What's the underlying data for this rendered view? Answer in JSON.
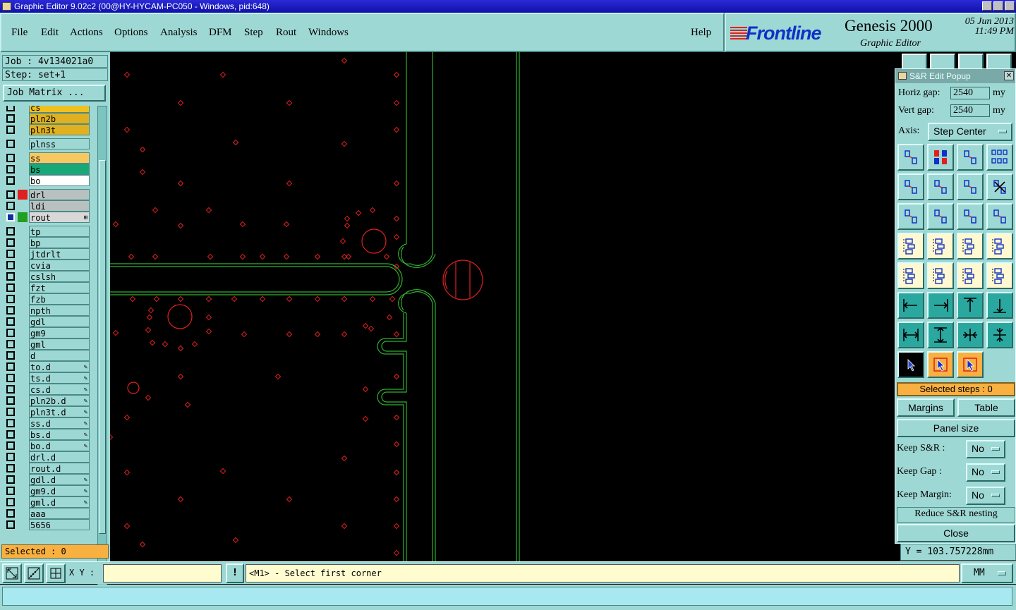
{
  "window": {
    "title": "Graphic Editor 9.02c2 (00@HY-HYCAM-PC050 - Windows, pid:648)"
  },
  "menu": {
    "items": [
      "File",
      "Edit",
      "Actions",
      "Options",
      "Analysis",
      "DFM",
      "Step",
      "Rout",
      "Windows"
    ],
    "help": "Help"
  },
  "brand": {
    "logo": "Frontline",
    "product": "Genesis 2000",
    "date": "05 Jun 2013",
    "time": "11:49 PM",
    "subtitle": "Graphic Editor"
  },
  "job": {
    "job_label": "Job  : 4v134021a0",
    "step_label": "Step: set+1",
    "matrix_button": "Job Matrix ...",
    "selected": "Selected : 0"
  },
  "layers": [
    {
      "name": "cs",
      "bg": "#f0c020",
      "swatch": ""
    },
    {
      "name": "pln2b",
      "bg": "#e0b020",
      "swatch": ""
    },
    {
      "name": "pln3t",
      "bg": "#e0b020",
      "swatch": ""
    },
    {
      "name": "plnss",
      "bg": "#9ed8d4",
      "swatch": ""
    },
    {
      "name": "ss",
      "bg": "#f8c860",
      "swatch": ""
    },
    {
      "name": "bs",
      "bg": "#18a878",
      "swatch": ""
    },
    {
      "name": "bo",
      "bg": "#ffffff",
      "swatch": ""
    },
    {
      "name": "drl",
      "bg": "#b8c0c0",
      "swatch": "#e02020"
    },
    {
      "name": "ldi",
      "bg": "#b8c0c0",
      "swatch": ""
    },
    {
      "name": "rout",
      "bg": "#d8d8d8",
      "swatch": "#20a020",
      "mark": "⊞",
      "active": true
    },
    {
      "name": "tp",
      "bg": "#9ed8d4",
      "swatch": ""
    },
    {
      "name": "bp",
      "bg": "#9ed8d4",
      "swatch": ""
    },
    {
      "name": "jtdrlt",
      "bg": "#9ed8d4",
      "swatch": ""
    },
    {
      "name": "cvia",
      "bg": "#9ed8d4",
      "swatch": ""
    },
    {
      "name": "cslsh",
      "bg": "#9ed8d4",
      "swatch": ""
    },
    {
      "name": "fzt",
      "bg": "#9ed8d4",
      "swatch": ""
    },
    {
      "name": "fzb",
      "bg": "#9ed8d4",
      "swatch": ""
    },
    {
      "name": "npth",
      "bg": "#9ed8d4",
      "swatch": ""
    },
    {
      "name": "gdl",
      "bg": "#9ed8d4",
      "swatch": ""
    },
    {
      "name": "gm9",
      "bg": "#9ed8d4",
      "swatch": ""
    },
    {
      "name": "gml",
      "bg": "#9ed8d4",
      "swatch": ""
    },
    {
      "name": "d",
      "bg": "#9ed8d4",
      "swatch": ""
    },
    {
      "name": "to.d",
      "bg": "#9ed8d4",
      "swatch": "",
      "mark": "✎"
    },
    {
      "name": "ts.d",
      "bg": "#9ed8d4",
      "swatch": "",
      "mark": "✎"
    },
    {
      "name": "cs.d",
      "bg": "#9ed8d4",
      "swatch": "",
      "mark": "✎"
    },
    {
      "name": "pln2b.d",
      "bg": "#9ed8d4",
      "swatch": "",
      "mark": "✎"
    },
    {
      "name": "pln3t.d",
      "bg": "#9ed8d4",
      "swatch": "",
      "mark": "✎"
    },
    {
      "name": "ss.d",
      "bg": "#9ed8d4",
      "swatch": "",
      "mark": "✎"
    },
    {
      "name": "bs.d",
      "bg": "#9ed8d4",
      "swatch": "",
      "mark": "✎"
    },
    {
      "name": "bo.d",
      "bg": "#9ed8d4",
      "swatch": "",
      "mark": "✎"
    },
    {
      "name": "drl.d",
      "bg": "#9ed8d4",
      "swatch": ""
    },
    {
      "name": "rout.d",
      "bg": "#9ed8d4",
      "swatch": ""
    },
    {
      "name": "gdl.d",
      "bg": "#9ed8d4",
      "swatch": "",
      "mark": "✎"
    },
    {
      "name": "gm9.d",
      "bg": "#9ed8d4",
      "swatch": "",
      "mark": "✎"
    },
    {
      "name": "gml.d",
      "bg": "#9ed8d4",
      "swatch": "",
      "mark": "✎"
    },
    {
      "name": "aaa",
      "bg": "#9ed8d4",
      "swatch": ""
    },
    {
      "name": "5656",
      "bg": "#9ed8d4",
      "swatch": ""
    }
  ],
  "popup": {
    "title": "S&R Edit Popup",
    "horiz_label": "Horiz gap:",
    "horiz_value": "2540",
    "horiz_unit": "my",
    "vert_label": "Vert  gap:",
    "vert_value": "2540",
    "vert_unit": "my",
    "axis_label": "Axis:",
    "axis_value": "Step Center",
    "selected_steps": "Selected steps : 0",
    "margins": "Margins",
    "table": "Table",
    "panel_size": "Panel size",
    "keep_sr_label": "Keep S&R   :",
    "keep_sr_value": "No",
    "keep_gap_label": "Keep Gap    :",
    "keep_gap_value": "No",
    "keep_margin_label": "Keep Margin:",
    "keep_margin_value": "No",
    "reduce": "Reduce S&R nesting",
    "close": "Close"
  },
  "coords": {
    "y_readout": "Y = 103.757228mm"
  },
  "bottom": {
    "xy_label": "X Y :",
    "xy_value": "",
    "excl": "!",
    "prompt": "<M1> - Select first corner",
    "units": "MM"
  },
  "colors": {
    "panel": "#9ed8d4",
    "canvas": "#000000",
    "drill": "#e02020",
    "rout": "#30b030",
    "selected": "#f8b040"
  }
}
